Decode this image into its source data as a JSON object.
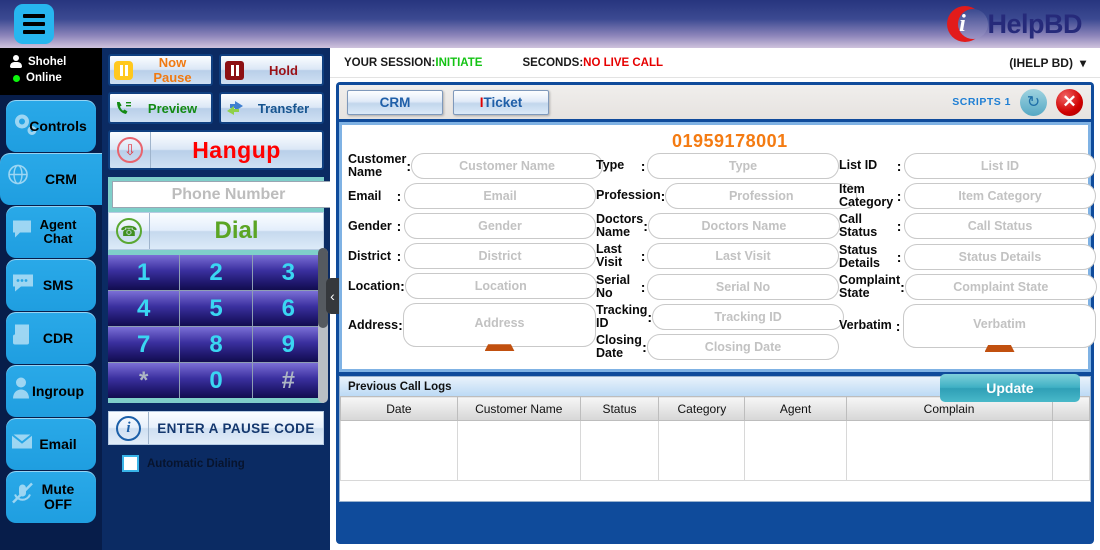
{
  "header": {
    "menu_icon": "hamburger-icon",
    "logo_mark": "i",
    "logo_text": "HelpBD"
  },
  "sidebar": {
    "user": {
      "name": "Shohel",
      "status": "Online"
    },
    "items": [
      {
        "label": "Controls",
        "icon": "gear-icon",
        "active": false
      },
      {
        "label": "CRM",
        "icon": "globe-icon",
        "active": true
      },
      {
        "label": "Agent Chat",
        "icon": "chat-bubble-icon",
        "active": false
      },
      {
        "label": "SMS",
        "icon": "sms-bubble-icon",
        "active": false
      },
      {
        "label": "CDR",
        "icon": "document-icon",
        "active": false
      },
      {
        "label": "Ingroup",
        "icon": "user-group-icon",
        "active": false
      },
      {
        "label": "Email",
        "icon": "envelope-icon",
        "active": false
      },
      {
        "label": "Mute OFF",
        "icon": "mic-mute-icon",
        "active": false
      }
    ]
  },
  "dialer": {
    "controls": [
      {
        "label": "Now Pause",
        "icon": "pause-icon"
      },
      {
        "label": "Hold",
        "icon": "pause-icon"
      },
      {
        "label": "Preview",
        "icon": "phone-preview-icon"
      },
      {
        "label": "Transfer",
        "icon": "transfer-arrow-icon"
      }
    ],
    "hangup_label": "Hangup",
    "hangup_icon": "hangup-phone-icon",
    "phone_placeholder": "Phone Number",
    "phone_value": "",
    "clear_icon": "backspace-icon",
    "dial_label": "Dial",
    "dial_icon": "phone-icon",
    "keys": [
      "1",
      "2",
      "3",
      "4",
      "5",
      "6",
      "7",
      "8",
      "9",
      "*",
      "0",
      "#"
    ],
    "pause_code_label": "ENTER A PAUSE CODE",
    "pause_code_icon": "info-icon",
    "auto_dial_label": "Automatic Dialing",
    "auto_dial_checked": false,
    "collapse_icon": "chevron-left-icon"
  },
  "session": {
    "session_label": "YOUR SESSION:",
    "session_value": "INITIATE",
    "seconds_label": "SECONDS:",
    "seconds_value": "NO LIVE CALL",
    "campaign": "(IHELP BD)",
    "campaign_chevron": "chevron-down-icon"
  },
  "tabs": {
    "items": [
      {
        "label": "CRM",
        "prefix": "",
        "active": true
      },
      {
        "label": "Ticket",
        "prefix": "I",
        "active": false
      }
    ],
    "scripts_label": "SCRIPTS 1",
    "refresh_icon": "refresh-icon",
    "close_icon": "close-icon"
  },
  "form": {
    "phone_number": "01959178001",
    "columns": [
      {
        "fields": [
          {
            "label": "Customer Name",
            "placeholder": "Customer Name",
            "value": "",
            "type": "input",
            "name": "customer-name"
          },
          {
            "label": "Email",
            "placeholder": "Email",
            "value": "",
            "type": "input",
            "name": "email"
          },
          {
            "label": "Gender",
            "placeholder": "Gender",
            "value": "",
            "type": "input",
            "name": "gender"
          },
          {
            "label": "District",
            "placeholder": "District",
            "value": "",
            "type": "input",
            "name": "district"
          },
          {
            "label": "Location",
            "placeholder": "Location",
            "value": "",
            "type": "input",
            "name": "location"
          },
          {
            "label": "Address",
            "placeholder": "Address",
            "value": "",
            "type": "textarea",
            "name": "address"
          }
        ]
      },
      {
        "fields": [
          {
            "label": "Type",
            "placeholder": "Type",
            "value": "",
            "type": "input",
            "name": "type"
          },
          {
            "label": "Profession",
            "placeholder": "Profession",
            "value": "",
            "type": "input",
            "name": "profession"
          },
          {
            "label": "Doctors Name",
            "placeholder": "Doctors Name",
            "value": "",
            "type": "input",
            "name": "doctors-name"
          },
          {
            "label": "Last Visit",
            "placeholder": "Last Visit",
            "value": "",
            "type": "input",
            "name": "last-visit"
          },
          {
            "label": "Serial No",
            "placeholder": "Serial No",
            "value": "",
            "type": "input",
            "name": "serial-no"
          },
          {
            "label": "Tracking ID",
            "placeholder": "Tracking ID",
            "value": "",
            "type": "input",
            "name": "tracking-id"
          },
          {
            "label": "Closing Date",
            "placeholder": "Closing Date",
            "value": "",
            "type": "input",
            "name": "closing-date"
          }
        ]
      },
      {
        "fields": [
          {
            "label": "List ID",
            "placeholder": "List ID",
            "value": "",
            "type": "input",
            "name": "list-id"
          },
          {
            "label": "Item Category",
            "placeholder": "Item Category",
            "value": "",
            "type": "input",
            "name": "item-category"
          },
          {
            "label": "Call Status",
            "placeholder": "Call Status",
            "value": "",
            "type": "input",
            "name": "call-status"
          },
          {
            "label": "Status Details",
            "placeholder": "Status Details",
            "value": "",
            "type": "input",
            "name": "status-details"
          },
          {
            "label": "Complaint State",
            "placeholder": "Complaint State",
            "value": "",
            "type": "input",
            "name": "complaint-state"
          },
          {
            "label": "Verbatim",
            "placeholder": "Verbatim",
            "value": "",
            "type": "textarea",
            "name": "verbatim"
          }
        ]
      }
    ],
    "update_label": "Update"
  },
  "call_logs": {
    "title": "Previous Call Logs",
    "columns": [
      "Date",
      "Customer Name",
      "Status",
      "Category",
      "Agent",
      "Complain",
      ""
    ],
    "rows": []
  }
}
